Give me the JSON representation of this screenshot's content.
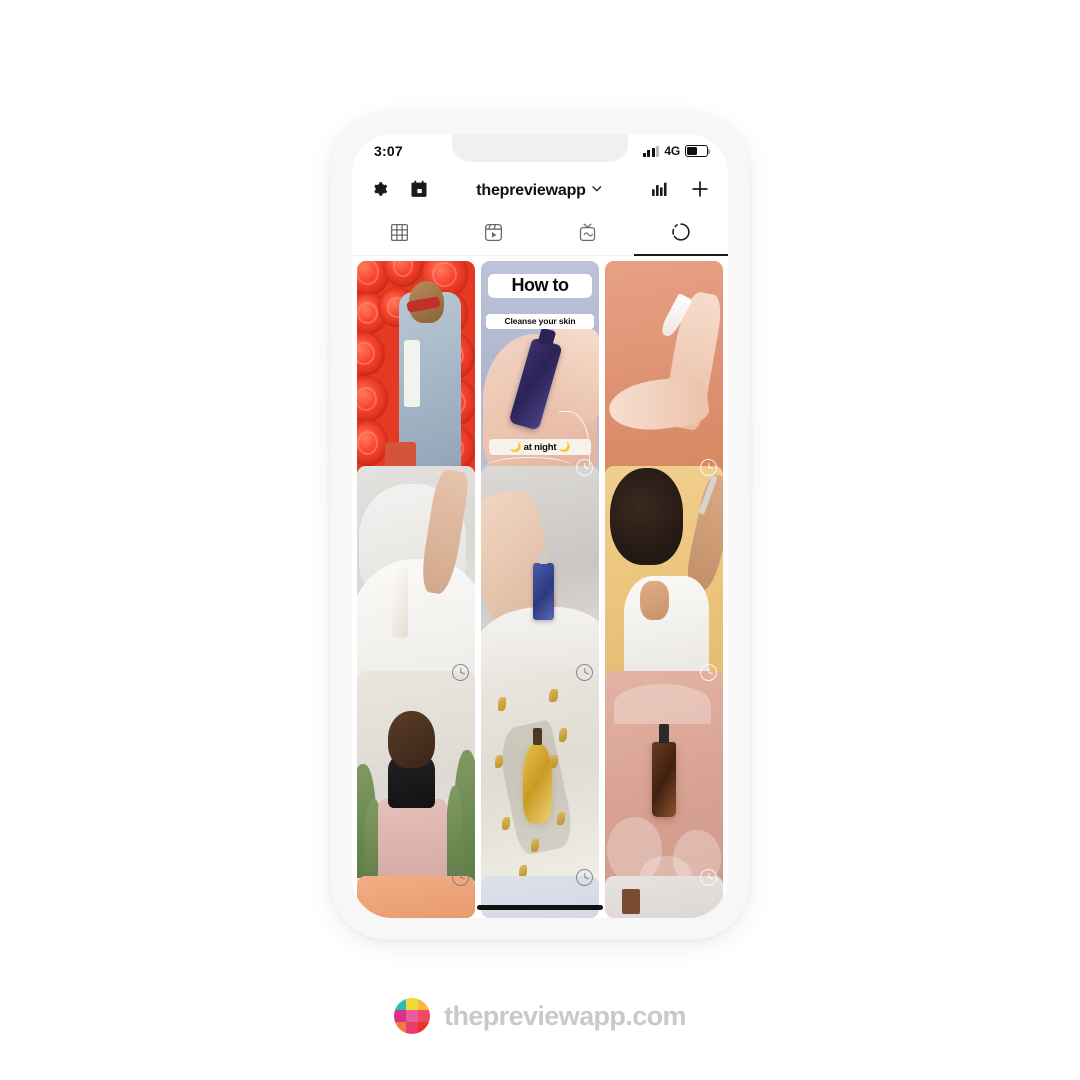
{
  "status_bar": {
    "time": "3:07",
    "network": "4G",
    "battery_level": 52,
    "signal_bars": 3
  },
  "app_header": {
    "settings_label": "Settings",
    "calendar_label": "Calendar",
    "username": "thepreviewapp",
    "chevron": "⌄",
    "analytics_label": "Analytics",
    "add_label": "Add"
  },
  "tabs": [
    {
      "id": "grid",
      "name": "Grid",
      "active": false
    },
    {
      "id": "reels",
      "name": "Reels",
      "active": false
    },
    {
      "id": "igtv",
      "name": "IGTV",
      "active": false
    },
    {
      "id": "scheduled",
      "name": "Scheduled",
      "active": true
    }
  ],
  "grid": {
    "rows": 3,
    "columns": 3,
    "cells": [
      {
        "id": "cell-1",
        "art": "roses",
        "description": "Woman in denim jacket in front of red rose wall",
        "scheduled": false,
        "badge": null
      },
      {
        "id": "cell-2",
        "art": "howto",
        "description": "How to cleanse your skin tutorial graphic",
        "overlay": {
          "title": "How to",
          "subtitle": "Cleanse your skin",
          "footer": "🌙 at night 🌙"
        },
        "scheduled": true,
        "badge": "clock-icon"
      },
      {
        "id": "cell-3",
        "art": "peach",
        "description": "Hands with white product bottle on peach background",
        "scheduled": true,
        "badge": "clock-icon"
      },
      {
        "id": "cell-4",
        "art": "sheets",
        "description": "Hand holding white serum bottle on white sheets",
        "scheduled": true,
        "badge": "clock-icon"
      },
      {
        "id": "cell-5",
        "art": "serum",
        "description": "Hand holding blue serum bottle",
        "scheduled": true,
        "badge": "clock-icon"
      },
      {
        "id": "cell-6",
        "art": "yellowbg",
        "description": "Woman with curly hair applying serum on yellow background",
        "scheduled": true,
        "badge": "clock-icon"
      },
      {
        "id": "cell-7",
        "art": "cactus",
        "description": "Smiling woman in black top and pink skirt beside cactus",
        "scheduled": true,
        "badge": "clock-icon"
      },
      {
        "id": "cell-8",
        "art": "gold",
        "description": "Gold perfume bottle with petals",
        "scheduled": true,
        "badge": "clock-icon"
      },
      {
        "id": "cell-9",
        "art": "amber",
        "description": "Amber dropper bottle on dusty pink with dried flowers",
        "scheduled": true,
        "badge": "clock-icon"
      }
    ],
    "partial_row": [
      {
        "id": "cell-10",
        "art": "p-peach",
        "description": "Peach toned post"
      },
      {
        "id": "cell-11",
        "art": "p-blue",
        "description": "Light blue toned post"
      },
      {
        "id": "cell-12",
        "art": "p-gray",
        "description": "Light gray toned post"
      }
    ]
  },
  "brand": {
    "name": "thepreviewapp.com",
    "logo_colors": [
      "#2bbcb4",
      "#f0d73a",
      "#f4b93c",
      "#d9318a",
      "#ee5a9e",
      "#ef4a63",
      "#f07b3f",
      "#ea3c6b",
      "#e8342e"
    ],
    "text_color": "#c9c9c9"
  },
  "theme": {
    "frame": "#f7f7f7",
    "screen_bg": "#ffffff",
    "active_tab_underline": "#1a1a1a",
    "divider": "#efefef"
  }
}
